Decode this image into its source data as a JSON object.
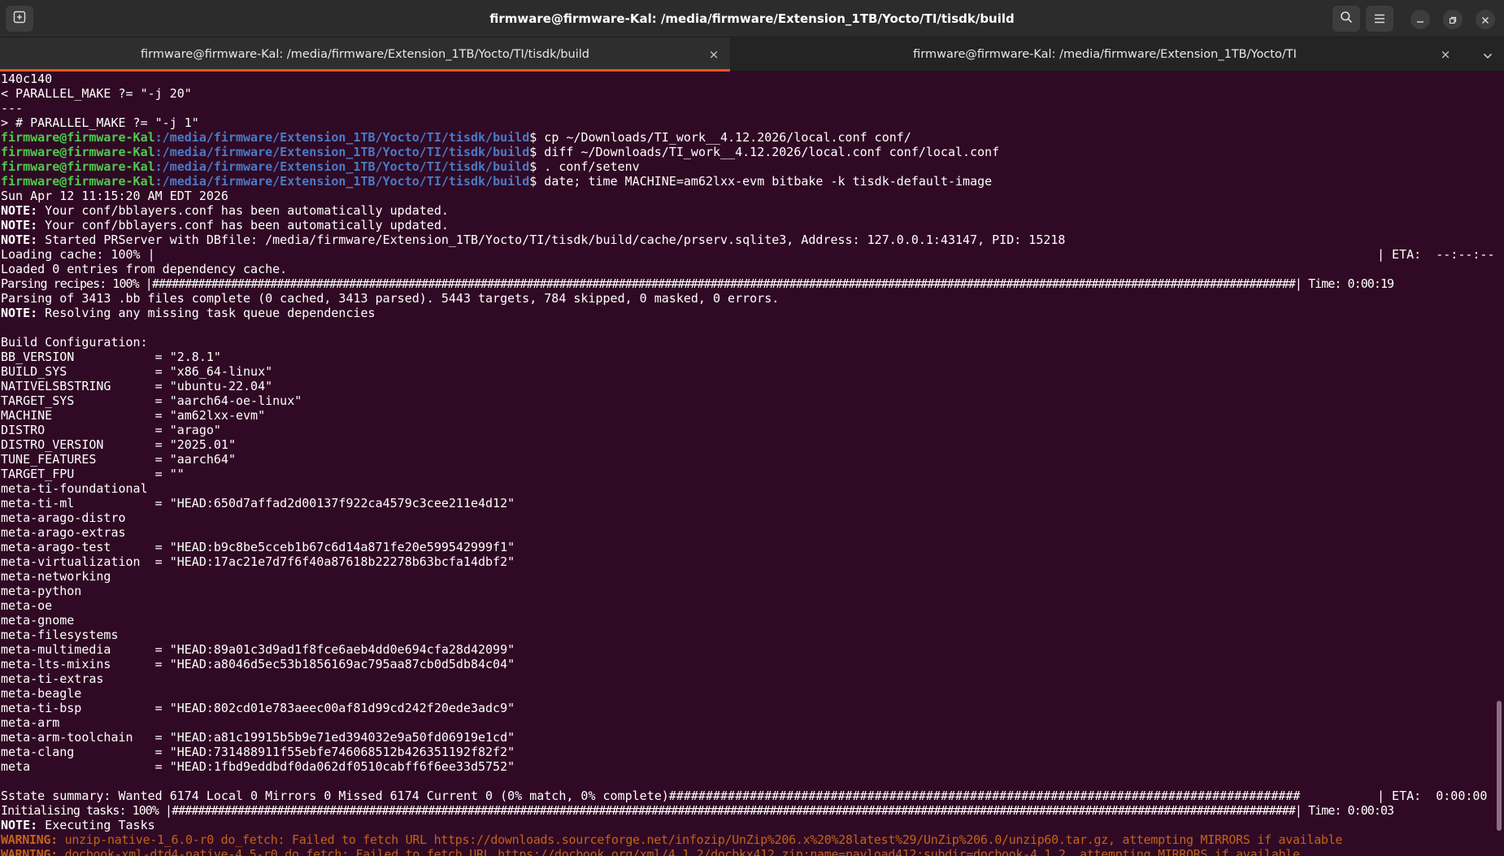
{
  "window": {
    "title": "firmware@firmware-Kal: /media/firmware/Extension_1TB/Yocto/TI/tisdk/build"
  },
  "tabs": [
    {
      "label": "firmware@firmware-Kal: /media/firmware/Extension_1TB/Yocto/TI/tisdk/build",
      "close": "×"
    },
    {
      "label": "firmware@firmware-Kal: /media/firmware/Extension_1TB/Yocto/TI",
      "close": "×"
    }
  ],
  "prompt": {
    "user": "firmware@firmware-Kal",
    "path": ":/media/firmware/Extension_1TB/Yocto/TI/tisdk/build",
    "sym": "$ "
  },
  "terminal": {
    "pre": [
      "140c140",
      "< PARALLEL_MAKE ?= \"-j 20\"",
      "---",
      "> # PARALLEL_MAKE ?= \"-j 1\""
    ],
    "commands": [
      "cp ~/Downloads/TI_work__4.12.2026/local.conf conf/",
      "diff ~/Downloads/TI_work__4.12.2026/local.conf conf/local.conf",
      ". conf/setenv",
      "date; time MACHINE=am62lxx-evm bitbake -k tisdk-default-image"
    ],
    "date_line": "Sun Apr 12 11:15:20 AM EDT 2026",
    "note_label": "NOTE:",
    "notes_top": [
      " Your conf/bblayers.conf has been automatically updated.",
      " Your conf/bblayers.conf has been automatically updated.",
      " Started PRServer with DBfile: /media/firmware/Extension_1TB/Yocto/TI/tisdk/build/cache/prserv.sqlite3, Address: 127.0.0.1:43147, PID: 15218"
    ],
    "loading_cache": "Loading cache: 100% |",
    "loading_eta": "| ETA:  --:--:--",
    "loaded_entries": "Loaded 0 entries from dependency cache.",
    "parsing_recipes": "Parsing recipes: 100% |##############################################################################################################################################################################| Time: 0:00:19",
    "parsing_summary": "Parsing of 3413 .bb files complete (0 cached, 3413 parsed). 5443 targets, 784 skipped, 0 masked, 0 errors.",
    "note_resolving": " Resolving any missing task queue dependencies",
    "build_config_header": "Build Configuration:",
    "config": [
      "BB_VERSION           = \"2.8.1\"",
      "BUILD_SYS            = \"x86_64-linux\"",
      "NATIVELSBSTRING      = \"ubuntu-22.04\"",
      "TARGET_SYS           = \"aarch64-oe-linux\"",
      "MACHINE              = \"am62lxx-evm\"",
      "DISTRO               = \"arago\"",
      "DISTRO_VERSION       = \"2025.01\"",
      "TUNE_FEATURES        = \"aarch64\"",
      "TARGET_FPU           = \"\"",
      "meta-ti-foundational",
      "meta-ti-ml           = \"HEAD:650d7affad2d00137f922ca4579c3cee211e4d12\"",
      "meta-arago-distro",
      "meta-arago-extras",
      "meta-arago-test      = \"HEAD:b9c8be5cceb1b67c6d14a871fe20e599542999f1\"",
      "meta-virtualization  = \"HEAD:17ac21e7d7f6f40a87618b22278b63bcfa14dbf2\"",
      "meta-networking",
      "meta-python",
      "meta-oe",
      "meta-gnome",
      "meta-filesystems",
      "meta-multimedia      = \"HEAD:89a01c3d9ad1f8fce6aeb4dd0e694cfa28d42099\"",
      "meta-lts-mixins      = \"HEAD:a8046d5ec53b1856169ac795aa87cb0d5db84c04\"",
      "meta-ti-extras",
      "meta-beagle",
      "meta-ti-bsp          = \"HEAD:802cd01e783aeec00af81d99cd242f20ede3adc9\"",
      "meta-arm",
      "meta-arm-toolchain   = \"HEAD:a81c19915b5b9e71ed394032e9a50fd06919e1cd\"",
      "meta-clang           = \"HEAD:731488911f55ebfe746068512b426351192f82f2\"",
      "meta                 = \"HEAD:1fbd9eddbdf0da062df0510cabff6f6ee33d5752\""
    ],
    "sstate_summary": "Sstate summary: Wanted 6174 Local 0 Mirrors 0 Missed 6174 Current 0 (0% match, 0% complete)######################################################################################",
    "sstate_eta": "| ETA:  0:00:00",
    "init_tasks": "Initialising tasks: 100% |###########################################################################################################################################################################| Time: 0:00:03",
    "note_executing": " Executing Tasks",
    "warn_label": "WARNING:",
    "warnings": [
      " unzip-native-1_6.0-r0 do_fetch: Failed to fetch URL https://downloads.sourceforge.net/infozip/UnZip%206.x%20%28latest%29/UnZip%206.0/unzip60.tar.gz, attempting MIRRORS if available",
      " docbook-xml-dtd4-native-4.5-r0 do_fetch: Failed to fetch URL https://docbook.org/xml/4.1.2/docbkx412.zip;name=payload412;subdir=docbook-4.1.2, attempting MIRRORS if available"
    ]
  },
  "icons": {
    "new_tab": "new-tab-icon",
    "search": "search-icon",
    "menu": "hamburger-menu-icon",
    "minimize": "minimize-icon",
    "maximize": "restore-icon",
    "close": "close-icon"
  },
  "colors": {
    "background": "#300a24",
    "prompt_user": "#4ec94e",
    "prompt_path": "#4a7ac8",
    "warning": "#c4621a",
    "tab_accent": "#e95420"
  }
}
